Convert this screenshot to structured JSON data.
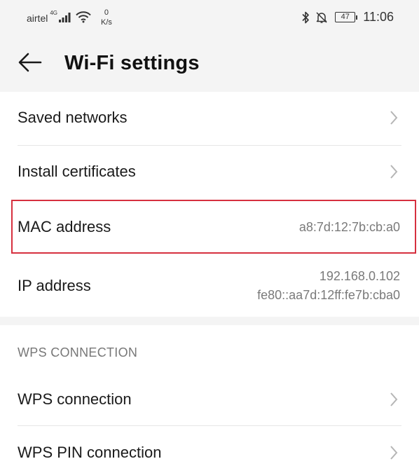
{
  "status_bar": {
    "carrier": "airtel",
    "network_type": "4G",
    "net_speed_value": "0",
    "net_speed_unit": "K/s",
    "battery_level": "47",
    "time": "11:06"
  },
  "header": {
    "title": "Wi-Fi settings",
    "back_icon": "arrow-left-icon"
  },
  "settings": {
    "saved_networks": "Saved networks",
    "install_certificates": "Install certificates",
    "mac_address_label": "MAC address",
    "mac_address_value": "a8:7d:12:7b:cb:a0",
    "ip_address_label": "IP address",
    "ip_v4": "192.168.0.102",
    "ip_v6": "fe80::aa7d:12ff:fe7b:cba0"
  },
  "wps": {
    "section_title": "WPS CONNECTION",
    "wps_connection": "WPS connection",
    "wps_pin_connection": "WPS PIN connection"
  },
  "colors": {
    "highlight_border": "#d6303f",
    "background": "#f4f4f4",
    "card": "#ffffff"
  }
}
